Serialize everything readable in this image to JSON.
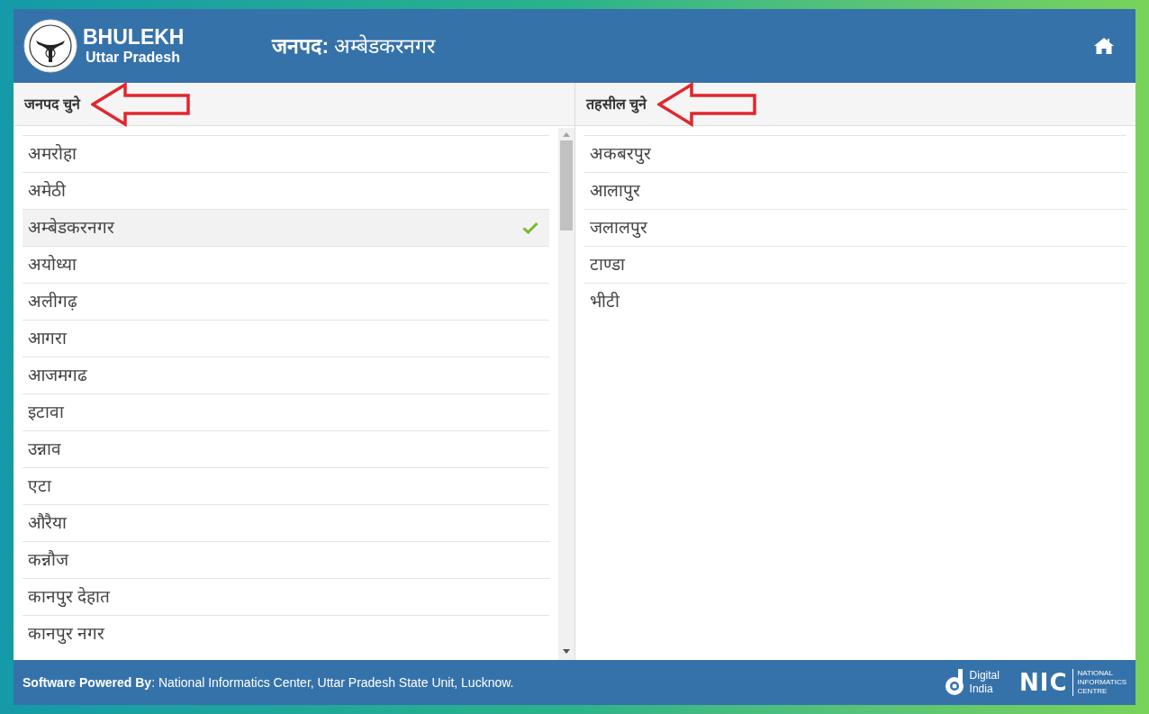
{
  "header": {
    "title": "BHULEKH",
    "subtitle": "Uttar Pradesh",
    "district_label": "जनपद:",
    "district_value": "अम्बेडकरनगर"
  },
  "panels": [
    {
      "heading": "जनपद चुने",
      "scrollable": true,
      "items": [
        {
          "label": "अमरोहा",
          "selected": false
        },
        {
          "label": "अमेठी",
          "selected": false
        },
        {
          "label": "अम्बेडकरनगर",
          "selected": true
        },
        {
          "label": "अयोध्या",
          "selected": false
        },
        {
          "label": "अलीगढ़",
          "selected": false
        },
        {
          "label": "आगरा",
          "selected": false
        },
        {
          "label": "आजमगढ",
          "selected": false
        },
        {
          "label": "इटावा",
          "selected": false
        },
        {
          "label": "उन्नाव",
          "selected": false
        },
        {
          "label": "एटा",
          "selected": false
        },
        {
          "label": "औरैया",
          "selected": false
        },
        {
          "label": "कन्नौज",
          "selected": false
        },
        {
          "label": "कानपुर देहात",
          "selected": false
        },
        {
          "label": "कानपुर नगर",
          "selected": false
        }
      ]
    },
    {
      "heading": "तहसील चुने",
      "scrollable": false,
      "items": [
        {
          "label": "अकबरपुर",
          "selected": false
        },
        {
          "label": "आलापुर",
          "selected": false
        },
        {
          "label": "जलालपुर",
          "selected": false
        },
        {
          "label": "टाण्डा",
          "selected": false
        },
        {
          "label": "भीटी",
          "selected": false
        }
      ]
    }
  ],
  "footer": {
    "credit": "**Software Powered By**: National Informatics Center, Uttar Pradesh State Unit, Lucknow.",
    "digital_india": [
      "Digital",
      "India"
    ],
    "nic_mark": "NIC",
    "nic_name": [
      "NATIONAL",
      "INFORMATICS",
      "CENTRE"
    ]
  }
}
